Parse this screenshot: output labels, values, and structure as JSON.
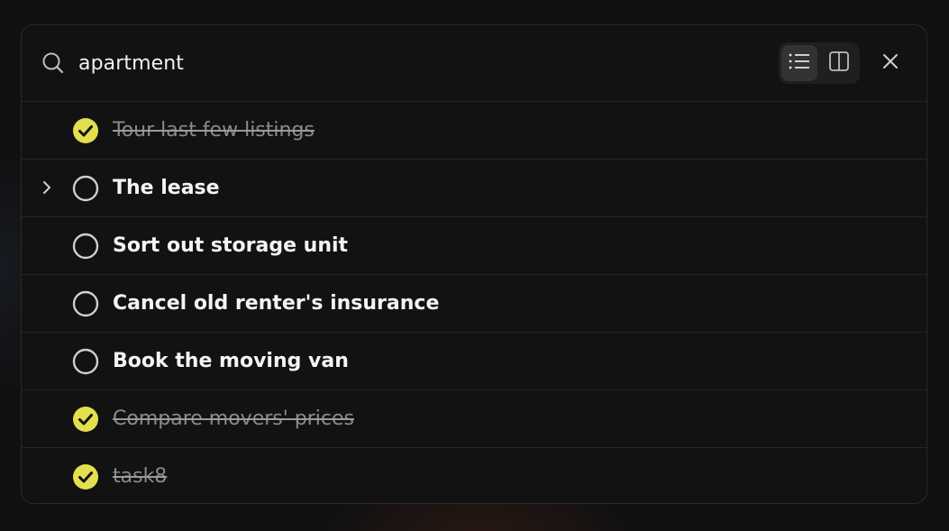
{
  "search": {
    "query": "apartment"
  },
  "colors": {
    "accent_done": "#e4df4f",
    "text_primary": "#f4f4f4",
    "text_done": "#8a8a8c",
    "panel_bg": "#121213"
  },
  "icons": {
    "search": "search-icon",
    "list_view": "list-icon",
    "split_view": "columns-icon",
    "close": "close-icon",
    "expand": "chevron-right-icon"
  },
  "tasks": [
    {
      "label": "Tour last few listings",
      "done": true,
      "expandable": false
    },
    {
      "label": "The lease",
      "done": false,
      "expandable": true
    },
    {
      "label": "Sort out storage unit",
      "done": false,
      "expandable": false
    },
    {
      "label": "Cancel old renter's insurance",
      "done": false,
      "expandable": false
    },
    {
      "label": "Book the moving van",
      "done": false,
      "expandable": false
    },
    {
      "label": "Compare movers' prices",
      "done": true,
      "expandable": false
    },
    {
      "label": "task8",
      "done": true,
      "expandable": false
    }
  ]
}
